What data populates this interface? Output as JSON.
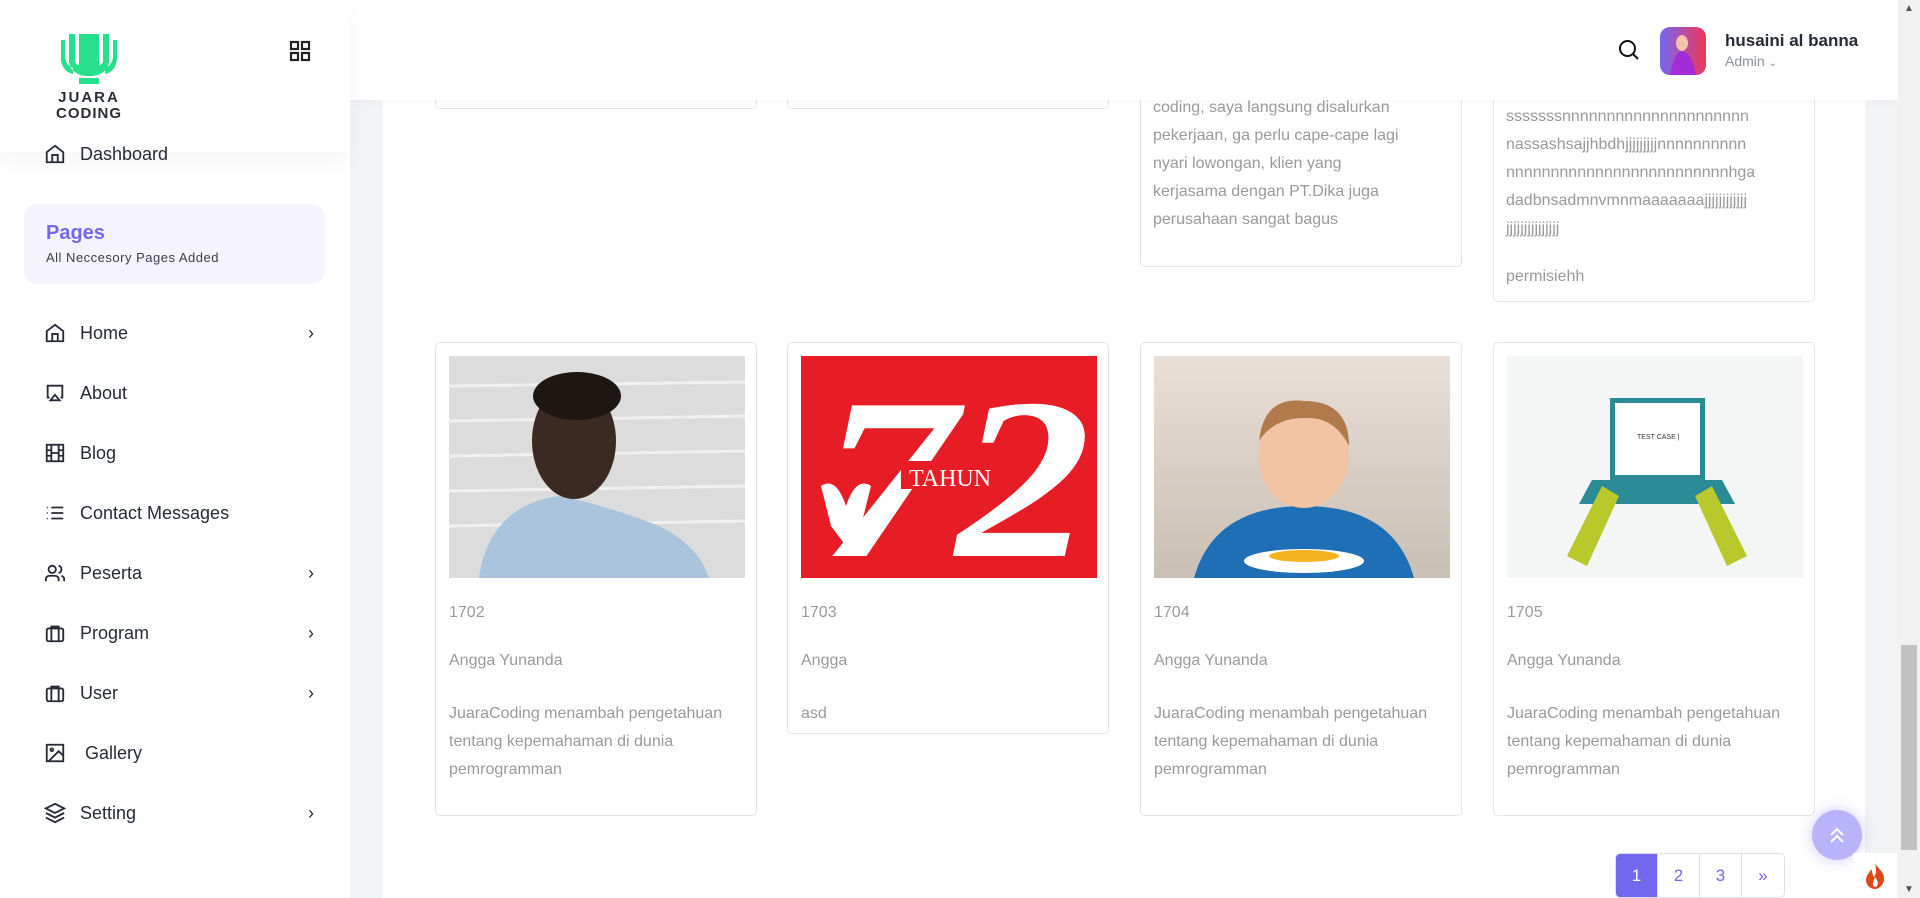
{
  "brand": {
    "logo_text": "JUARA CODING",
    "accent": "#7367f0",
    "logo_color": "#28e08c"
  },
  "sidebar": {
    "dashboard": "Dashboard",
    "section": {
      "title": "Pages",
      "subtitle": "All Neccesory Pages Added"
    },
    "items": [
      {
        "label": "Home",
        "icon": "home-icon",
        "chevron": true
      },
      {
        "label": "About",
        "icon": "airplay-icon",
        "chevron": false
      },
      {
        "label": "Blog",
        "icon": "film-icon",
        "chevron": false
      },
      {
        "label": "Contact Messages",
        "icon": "list-icon",
        "chevron": false
      },
      {
        "label": "Peserta",
        "icon": "users-icon",
        "chevron": true
      },
      {
        "label": "Program",
        "icon": "briefcase-icon",
        "chevron": true
      },
      {
        "label": "User",
        "icon": "briefcase-icon",
        "chevron": true
      },
      {
        "label": "Gallery",
        "icon": "image-icon",
        "chevron": false
      },
      {
        "label": "Setting",
        "icon": "layers-icon",
        "chevron": true
      }
    ]
  },
  "header": {
    "user_name": "husaini al banna",
    "user_role": "Admin"
  },
  "top_row": {
    "card3_lines": [
      "coding, saya langsung disalurkan",
      "pekerjaan, ga perlu cape-cape lagi",
      "nyari lowongan, klien yang",
      "kerjasama dengan PT.Dika juga",
      "perusahaan sangat bagus"
    ],
    "card4_lines": [
      "sssssssnnnnnnnnnnnnnnnnnnnnn",
      "nassashsajjhbdhjjjjjjjjjnnnnnnnnnn",
      "nnnnnnnnnnnnnnnnnnnnnnnnnhga",
      "dadbnsadmnvmnmaaaaaaajjjjjjjjjjjj",
      "jjjjjjjjjjjjjjj"
    ],
    "card4_name": "permisiehh"
  },
  "cards": [
    {
      "id": "1702",
      "name": "Angga Yunanda",
      "desc": "JuaraCoding menambah pengetahuan tentang kepemahaman di dunia pemrogramman"
    },
    {
      "id": "1703",
      "name": "Angga",
      "desc": "asd",
      "image_text": [
        "72",
        "TAHUN"
      ]
    },
    {
      "id": "1704",
      "name": "Angga Yunanda",
      "desc": "JuaraCoding menambah pengetahuan tentang kepemahaman di dunia pemrogramman"
    },
    {
      "id": "1705",
      "name": "Angga Yunanda",
      "desc": "JuaraCoding menambah pengetahuan tentang kepemahaman di dunia pemrogramman",
      "image_text": [
        "TEST CASE |"
      ]
    }
  ],
  "pagination": {
    "pages": [
      "1",
      "2",
      "3"
    ],
    "next": "»",
    "active": "1"
  }
}
